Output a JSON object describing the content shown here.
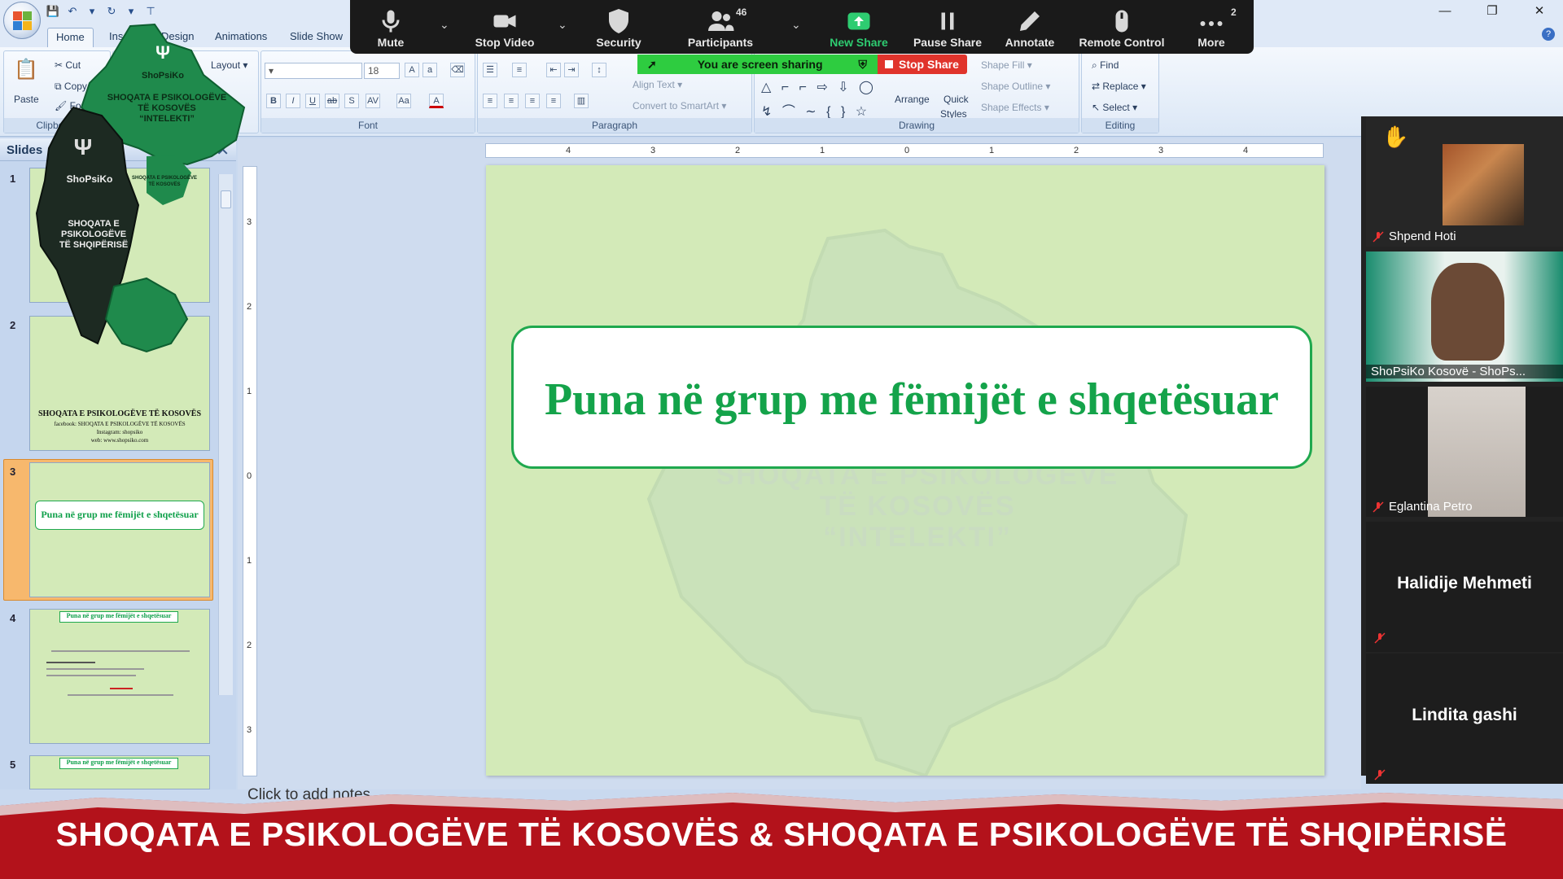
{
  "window": {
    "minimize": "—",
    "restore": "❐",
    "close": "✕"
  },
  "ribbon": {
    "tabs": [
      "Home",
      "Insert",
      "Design",
      "Animations",
      "Slide Show"
    ],
    "clipboard": {
      "paste": "Paste",
      "cut": "Cut",
      "copy": "Copy",
      "format": "Format Painter",
      "label": "Clipboard"
    },
    "slides": {
      "layout": "Layout"
    },
    "font": {
      "size": "18",
      "label": "Font"
    },
    "paragraph": {
      "align_text": "Align Text",
      "convert": "Convert to SmartArt",
      "label": "Paragraph"
    },
    "drawing": {
      "arrange": "Arrange",
      "quick_styles_1": "Quick",
      "quick_styles_2": "Styles",
      "shape_fill": "Shape Fill",
      "shape_outline": "Shape Outline",
      "shape_effects": "Shape Effects",
      "label": "Drawing"
    },
    "editing": {
      "find": "Find",
      "replace": "Replace",
      "select": "Select",
      "label": "Editing"
    }
  },
  "zoom": {
    "buttons": [
      {
        "label": "Mute",
        "icon": "microphone-icon"
      },
      {
        "label": "Stop Video",
        "icon": "camera-icon"
      },
      {
        "label": "Security",
        "icon": "shield-icon"
      },
      {
        "label": "Participants",
        "icon": "people-icon"
      },
      {
        "label": "New Share",
        "icon": "share-up-icon"
      },
      {
        "label": "Pause Share",
        "icon": "pause-icon"
      },
      {
        "label": "Annotate",
        "icon": "pencil-icon"
      },
      {
        "label": "Remote Control",
        "icon": "mouse-icon"
      },
      {
        "label": "More",
        "icon": "more-dots-icon"
      }
    ],
    "participants_count": "46",
    "more_count": "2",
    "sharing_text": "You are screen sharing",
    "stop_share": "Stop Share"
  },
  "slides_pane": {
    "header": "Slides",
    "close": "✕",
    "numbers": [
      "1",
      "2",
      "3",
      "4",
      "5"
    ],
    "thumb2_line1": "SHOQATA E PSIKOLOGËVE TË KOSOVËS",
    "thumb2_line2": "facebook: SHOQATA E PSIKOLOGËVE TË KOSOVËS",
    "thumb2_line3": "Instagram: shopsiko",
    "thumb2_line4": "web: www.shopsiko.com",
    "thumb_title": "Puna në grup me fëmijët e shqetësuar"
  },
  "ruler": {
    "h": [
      "4",
      "3",
      "2",
      "1",
      "0",
      "1",
      "2",
      "3",
      "4"
    ],
    "v": [
      "3",
      "2",
      "1",
      "0",
      "1",
      "2",
      "3"
    ]
  },
  "slide": {
    "title": "Puna në grup me fëmijët e shqetësuar",
    "watermark_lines": [
      "SHOQATA E PSIKOLOGËVE",
      "TË KOSOVËS",
      "“INTELEKTI”"
    ]
  },
  "notes_hint": "Click to add notes",
  "logos": {
    "kosovo_brand": "ShoPsiKo",
    "kosovo_lines": [
      "SHOQATA E PSIKOLOGËVE",
      "TË KOSOVËS",
      "“INTELEKTI”"
    ],
    "albania_brand": "ShoPsiKo",
    "albania_lines": [
      "SHOQATA E",
      "PSIKOLOGËVE",
      "TË SHQIPËRISË"
    ],
    "right_small": [
      "SHOQATA E PSIKOLOGËVE",
      "TË KOSOVËS"
    ]
  },
  "participants": [
    {
      "name": "Shpend Hoti"
    },
    {
      "name": "ShoPsiKo Kosovë - ShoPs..."
    },
    {
      "name": "Eglantina Petro"
    },
    {
      "name": "Halidije Mehmeti"
    },
    {
      "name": "Lindita gashi"
    }
  ],
  "banner": {
    "text": "SHOQATA E PSIKOLOGËVE TË KOSOVËS  & SHOQATA E PSIKOLOGËVE TË SHQIPËRISË"
  },
  "colors": {
    "accent_green": "#14a34a",
    "slide_bg": "#d3eab8",
    "banner_red": "#b3121b",
    "zoom_bg": "#1a1a1a"
  }
}
